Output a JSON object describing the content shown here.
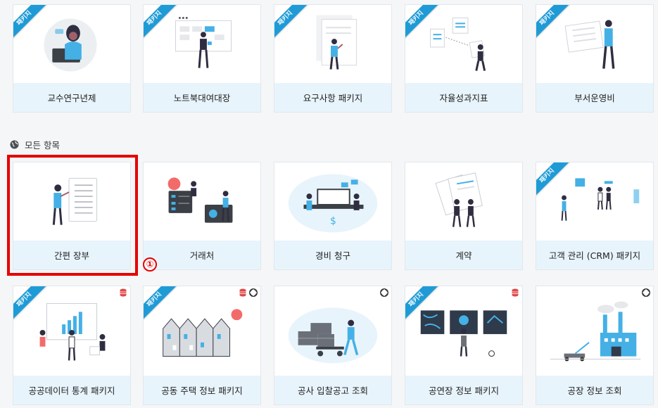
{
  "section": {
    "title": "모든 항목"
  },
  "ribbon_label": "패키지",
  "annotation_badge": "①",
  "rows": {
    "top": [
      {
        "label": "교수연구년제",
        "package": true
      },
      {
        "label": "노트북대여대장",
        "package": true
      },
      {
        "label": "요구사항 패키지",
        "package": true
      },
      {
        "label": "자율성과지표",
        "package": true
      },
      {
        "label": "부서운영비",
        "package": true
      }
    ],
    "middle": [
      {
        "label": "간편 장부",
        "package": false,
        "selected": true
      },
      {
        "label": "거래처",
        "package": false
      },
      {
        "label": "경비 청구",
        "package": false
      },
      {
        "label": "계약",
        "package": false
      },
      {
        "label": "고객 관리 (CRM) 패키지",
        "package": true
      }
    ],
    "bottom": [
      {
        "label": "공공데이터 통계 패키지",
        "package": true,
        "icons": [
          "database-icon"
        ]
      },
      {
        "label": "공동 주택 정보 패키지",
        "package": true,
        "icons": [
          "database-icon",
          "lifebuoy-icon"
        ]
      },
      {
        "label": "공사 입찰공고 조회",
        "package": false,
        "icons": [
          "lifebuoy-icon"
        ]
      },
      {
        "label": "공연장 정보 패키지",
        "package": true,
        "icons": [
          "database-icon"
        ]
      },
      {
        "label": "공장 정보 조회",
        "package": false,
        "icons": [
          "lifebuoy-icon"
        ]
      }
    ]
  },
  "colors": {
    "accent": "#1e9bd7",
    "highlight": "#e60000",
    "label_bg": "#e8f4fc",
    "db_icon": "#e04848"
  }
}
